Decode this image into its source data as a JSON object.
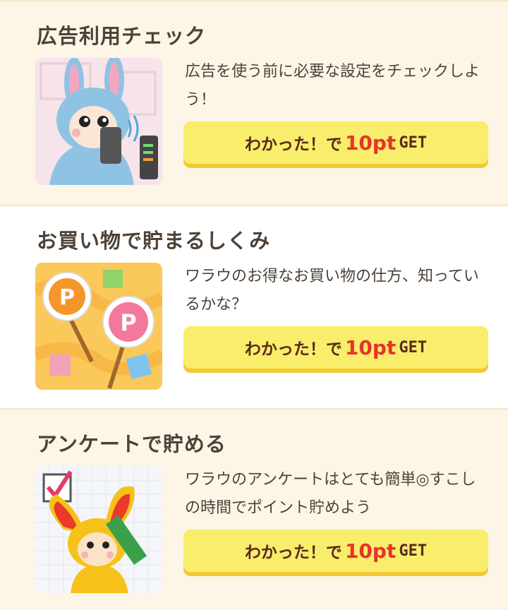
{
  "cards": [
    {
      "title": "広告利用チェック",
      "description": "広告を使う前に必要な設定をチェックしよう！",
      "button": {
        "prefix": "わかった！で",
        "points": "10pt",
        "suffix": "GET"
      },
      "thumb_icon": "bunny-router-illustration"
    },
    {
      "title": "お買い物で貯まるしくみ",
      "description": "ワラウのお得なお買い物の仕方、知っているかな？",
      "button": {
        "prefix": "わかった！で",
        "points": "10pt",
        "suffix": "GET"
      },
      "thumb_icon": "point-signs-illustration"
    },
    {
      "title": "アンケートで貯める",
      "description": "ワラウのアンケートはとても簡単◎すこしの時間でポイント貯めよう",
      "button": {
        "prefix": "わかった！で",
        "points": "10pt",
        "suffix": "GET"
      },
      "thumb_icon": "survey-bunny-illustration"
    }
  ],
  "colors": {
    "button_bg": "#f9ed6c",
    "button_shadow": "#f3c832",
    "points_red": "#e8322a"
  }
}
